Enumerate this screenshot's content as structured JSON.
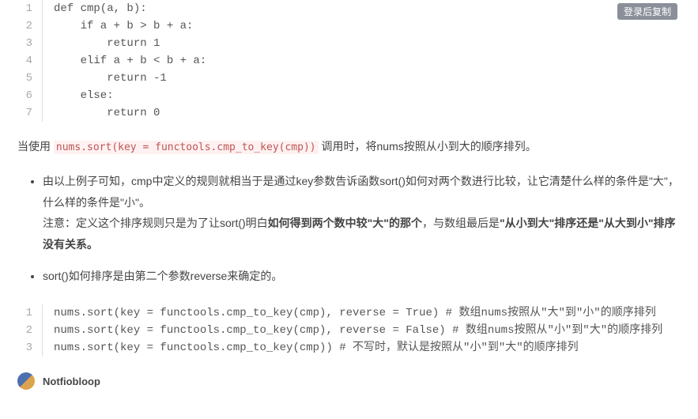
{
  "copy_label": "登录后复制",
  "code1": [
    "def cmp(a, b):",
    "    if a + b > b + a:",
    "        return 1",
    "    elif a + b < b + a:",
    "        return -1",
    "    else:",
    "        return 0"
  ],
  "para1_prefix": "当使用 ",
  "para1_code": "nums.sort(key = functools.cmp_to_key(cmp))",
  "para1_suffix": " 调用时，将nums按照从小到大的顺序排列。",
  "bullets": [
    {
      "line1": "由以上例子可知，cmp中定义的规则就相当于是通过key参数告诉函数sort()如何对两个数进行比较，让它清楚什么样的条件是\"大\"，什么样的条件是\"小\"。",
      "line2_prefix": "注意：定义这个排序规则只是为了让sort()明白",
      "line2_bold1": "如何得到两个数中较\"大\"的那个",
      "line2_mid": "，与数组最后是",
      "line2_bold2": "\"从小到大\"排序还是\"从大到小\"排序没有关系。"
    },
    {
      "line1": "sort()如何排序是由第二个参数reverse来确定的。"
    }
  ],
  "code2": [
    "nums.sort(key = functools.cmp_to_key(cmp), reverse = True) # 数组nums按照从\"大\"到\"小\"的顺序排列",
    "nums.sort(key = functools.cmp_to_key(cmp), reverse = False) # 数组nums按照从\"小\"到\"大\"的顺序排列",
    "nums.sort(key = functools.cmp_to_key(cmp)) # 不写时，默认是按照从\"小\"到\"大\"的顺序排列"
  ],
  "username": "Notfiobloop"
}
